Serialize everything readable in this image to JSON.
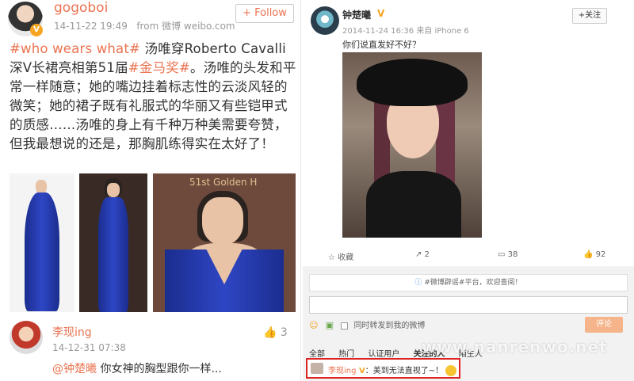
{
  "left_post": {
    "username": "gogoboi",
    "timestamp": "14-11-22 19:49",
    "source": "from 微博 weibo.com",
    "follow_label": "+ Follow",
    "text_tag1": "#who wears what#",
    "text_part1": " 汤唯穿Roberto Cavalli深V长裙亮相第51届",
    "text_tag2": "#金马奖#",
    "text_part2": "。汤唯的头发和平常一样随意；她的嘴边挂着标志性的云淡风轻的微笑；她的裙子既有礼服式的华丽又有些铠甲式的质感……汤唯的身上有千种万种美需要夸赞，但我最想说的还是，那胸肌练得实在太好了！",
    "photo3_caption": "51st Golden H"
  },
  "comment": {
    "username": "李现ing",
    "timestamp": "14-12-31 07:38",
    "like_count": "3",
    "mention": "@钟楚曦",
    "text": " 你女神的胸型跟你一样..."
  },
  "right_post": {
    "username": "钟楚曦",
    "timestamp": "2014-11-24 16:36",
    "source": "来自 iPhone 6",
    "follow_label": "+关注",
    "text": "你们说直发好不好？",
    "actions": {
      "favorite": "收藏",
      "repost": "2",
      "comments": "38",
      "likes": "92"
    },
    "notice": "#微博辟谣#平台，欢迎查阅！",
    "checkbox_label": "同时转发到我的微博",
    "submit_label": "评论",
    "filters": [
      "全部",
      "热门",
      "认证用户",
      "关注的人",
      "陌生人"
    ],
    "highlight_user": "李现ing",
    "highlight_text": "：美到无法直视了~！"
  },
  "watermark": "www.nanrenwo.net"
}
